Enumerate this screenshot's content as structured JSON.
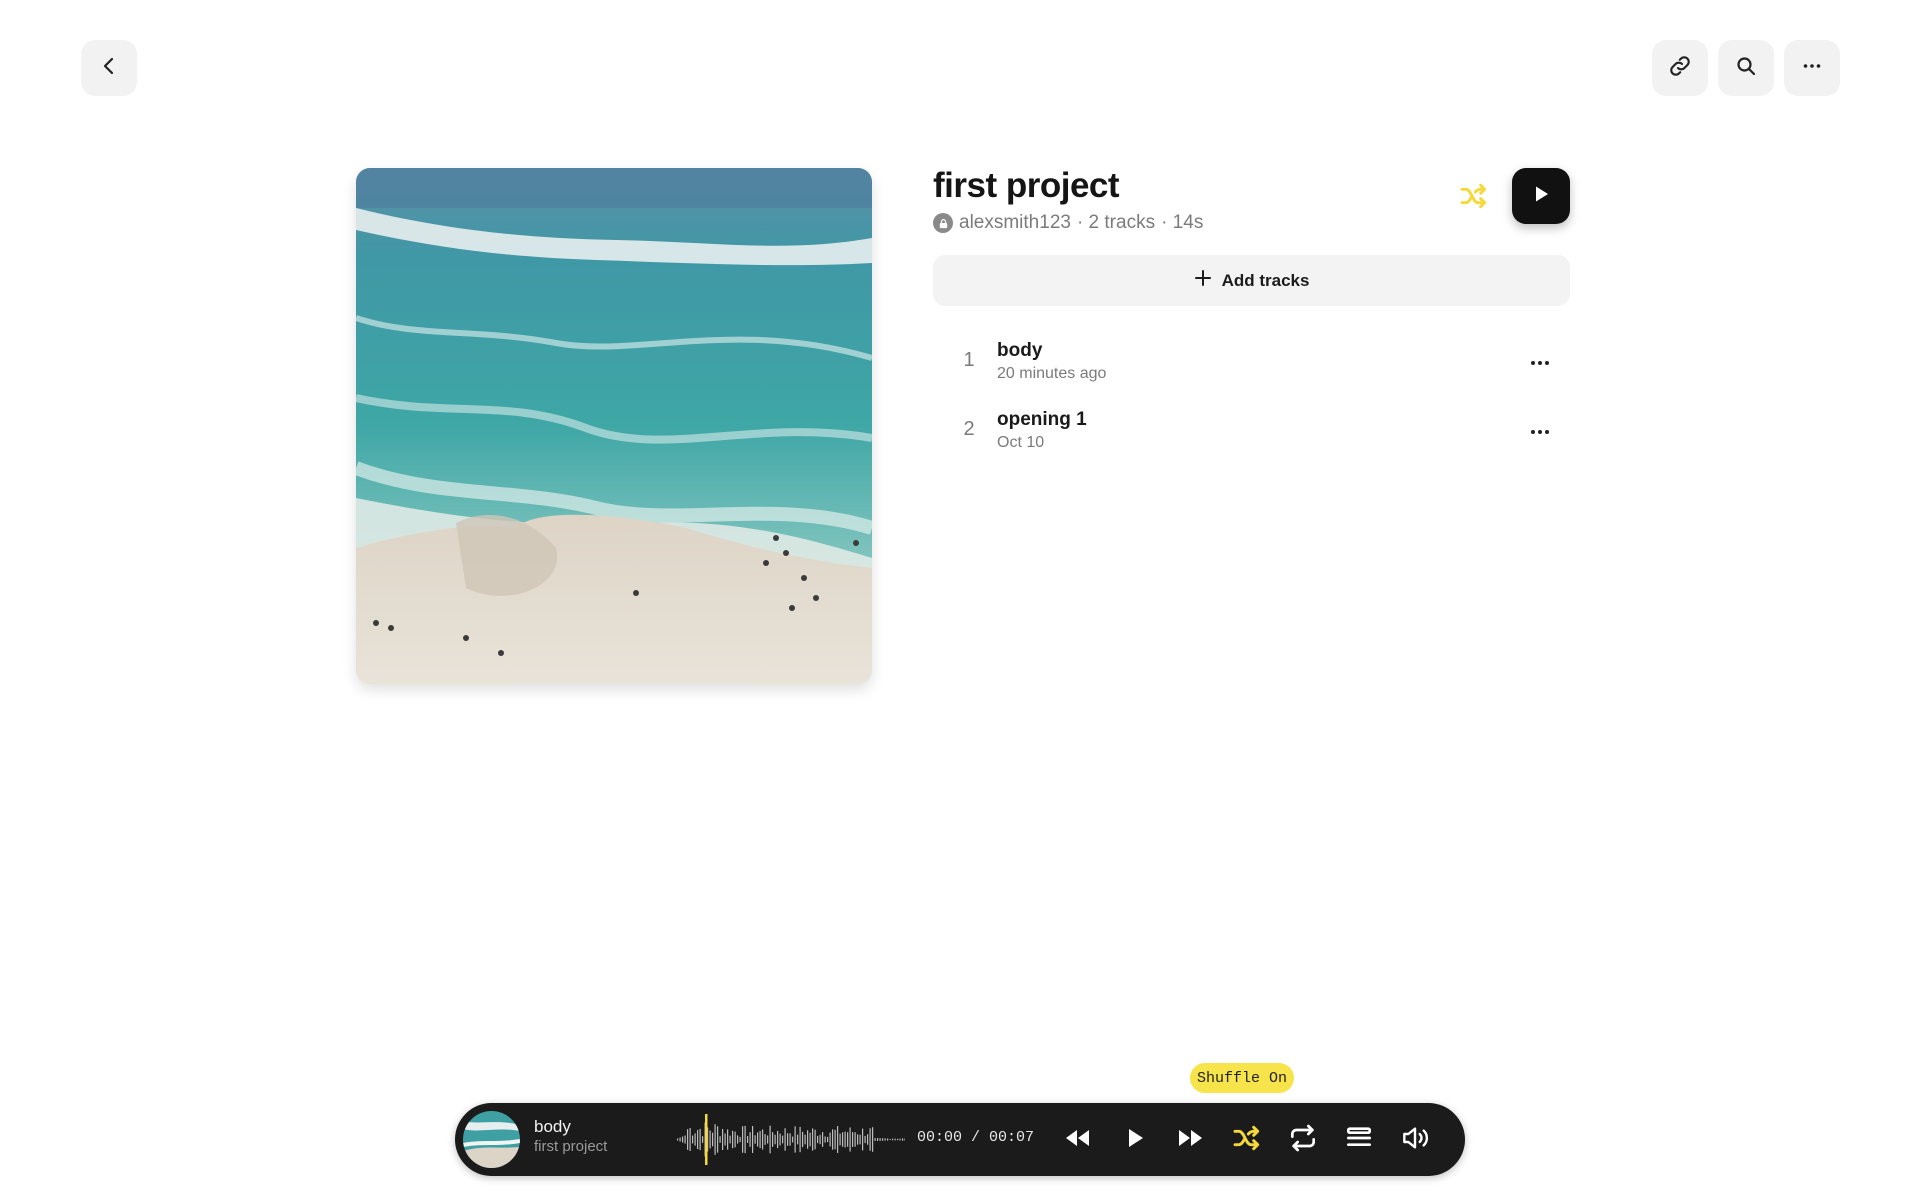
{
  "header": {
    "back_icon": "chevron-left-icon",
    "link_icon": "link-icon",
    "search_icon": "search-icon",
    "more_icon": "more-horizontal-icon"
  },
  "project": {
    "title": "first project",
    "owner": "alexsmith123",
    "track_count": "· 2 tracks",
    "duration": "· 14s",
    "visibility_icon": "lock-icon",
    "add_tracks_label": "Add tracks"
  },
  "tracks": [
    {
      "number": "1",
      "name": "body",
      "date": "20 minutes ago"
    },
    {
      "number": "2",
      "name": "opening 1",
      "date": "Oct 10"
    }
  ],
  "tooltip": {
    "text": "Shuffle On"
  },
  "player": {
    "title": "body",
    "subtitle": "first project",
    "time": "00:00 / 00:07",
    "progress": 0.0,
    "shuffle_active": true,
    "icons": [
      "rewind-icon",
      "play-icon",
      "fast-forward-icon",
      "shuffle-icon",
      "repeat-icon",
      "queue-icon",
      "volume-icon"
    ]
  },
  "colors": {
    "accent": "#f5d83a",
    "player_bg": "#1b1b1b",
    "button_bg": "#f2f2f2"
  }
}
